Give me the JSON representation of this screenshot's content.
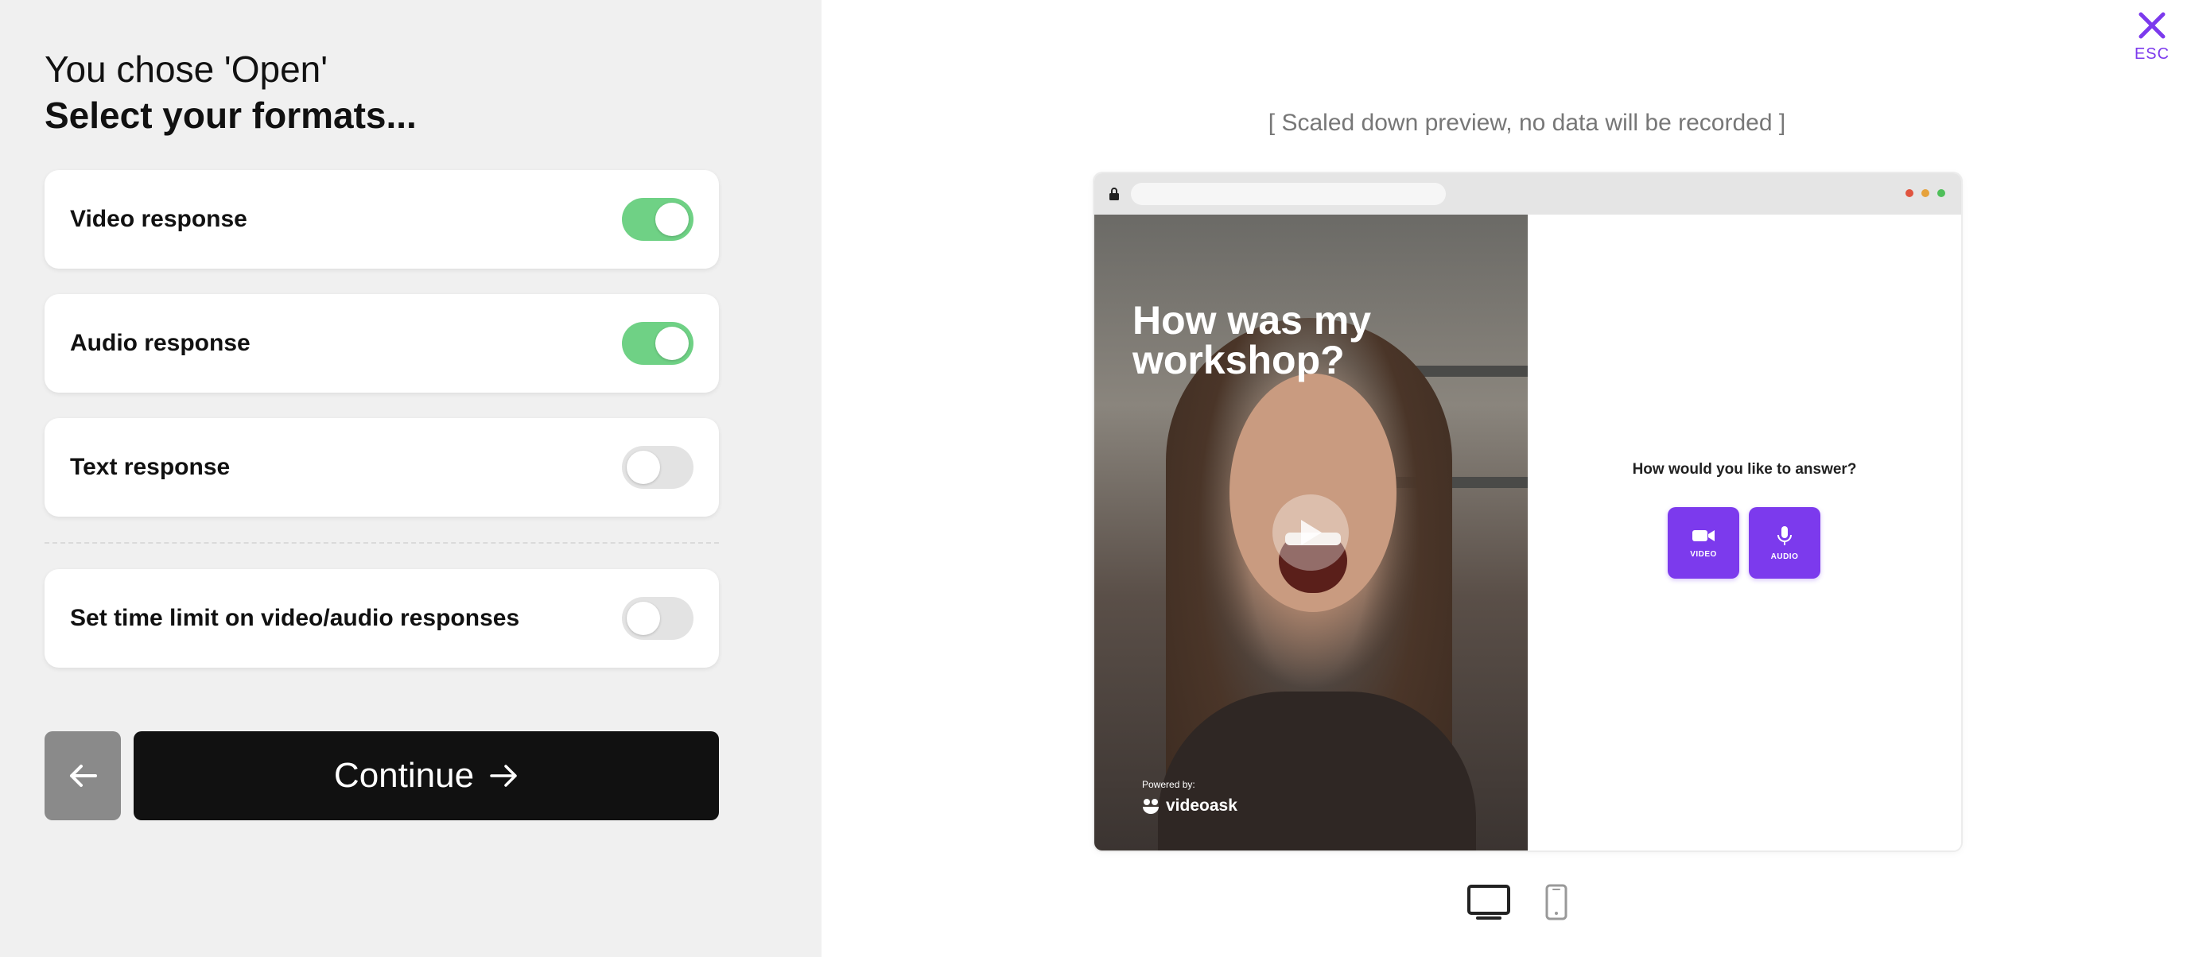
{
  "left": {
    "title_line1": "You chose 'Open'",
    "title_line2": "Select your formats...",
    "options": [
      {
        "label": "Video response",
        "enabled": true
      },
      {
        "label": "Audio response",
        "enabled": true
      },
      {
        "label": "Text response",
        "enabled": false
      }
    ],
    "time_limit": {
      "label": "Set time limit on video/audio responses",
      "enabled": false
    },
    "back_icon": "arrow-left-icon",
    "continue_label": "Continue",
    "continue_icon": "arrow-right-icon"
  },
  "close": {
    "icon": "close-icon",
    "label": "ESC"
  },
  "preview": {
    "note": "[ Scaled down preview, no data will be recorded ]",
    "video_title": "How was my workshop?",
    "powered_by": "Powered by:",
    "brand": "videoask",
    "question": "How would you like to answer?",
    "buttons": [
      {
        "label": "VIDEO",
        "icon": "video-camera-icon"
      },
      {
        "label": "AUDIO",
        "icon": "microphone-icon"
      }
    ]
  },
  "devices": {
    "desktop_icon": "desktop-icon",
    "mobile_icon": "mobile-icon"
  },
  "colors": {
    "accent": "#7c3aed",
    "toggle_on": "#6fd185",
    "toggle_off": "#e3e3e3",
    "panel_bg": "#f0f0f0"
  }
}
